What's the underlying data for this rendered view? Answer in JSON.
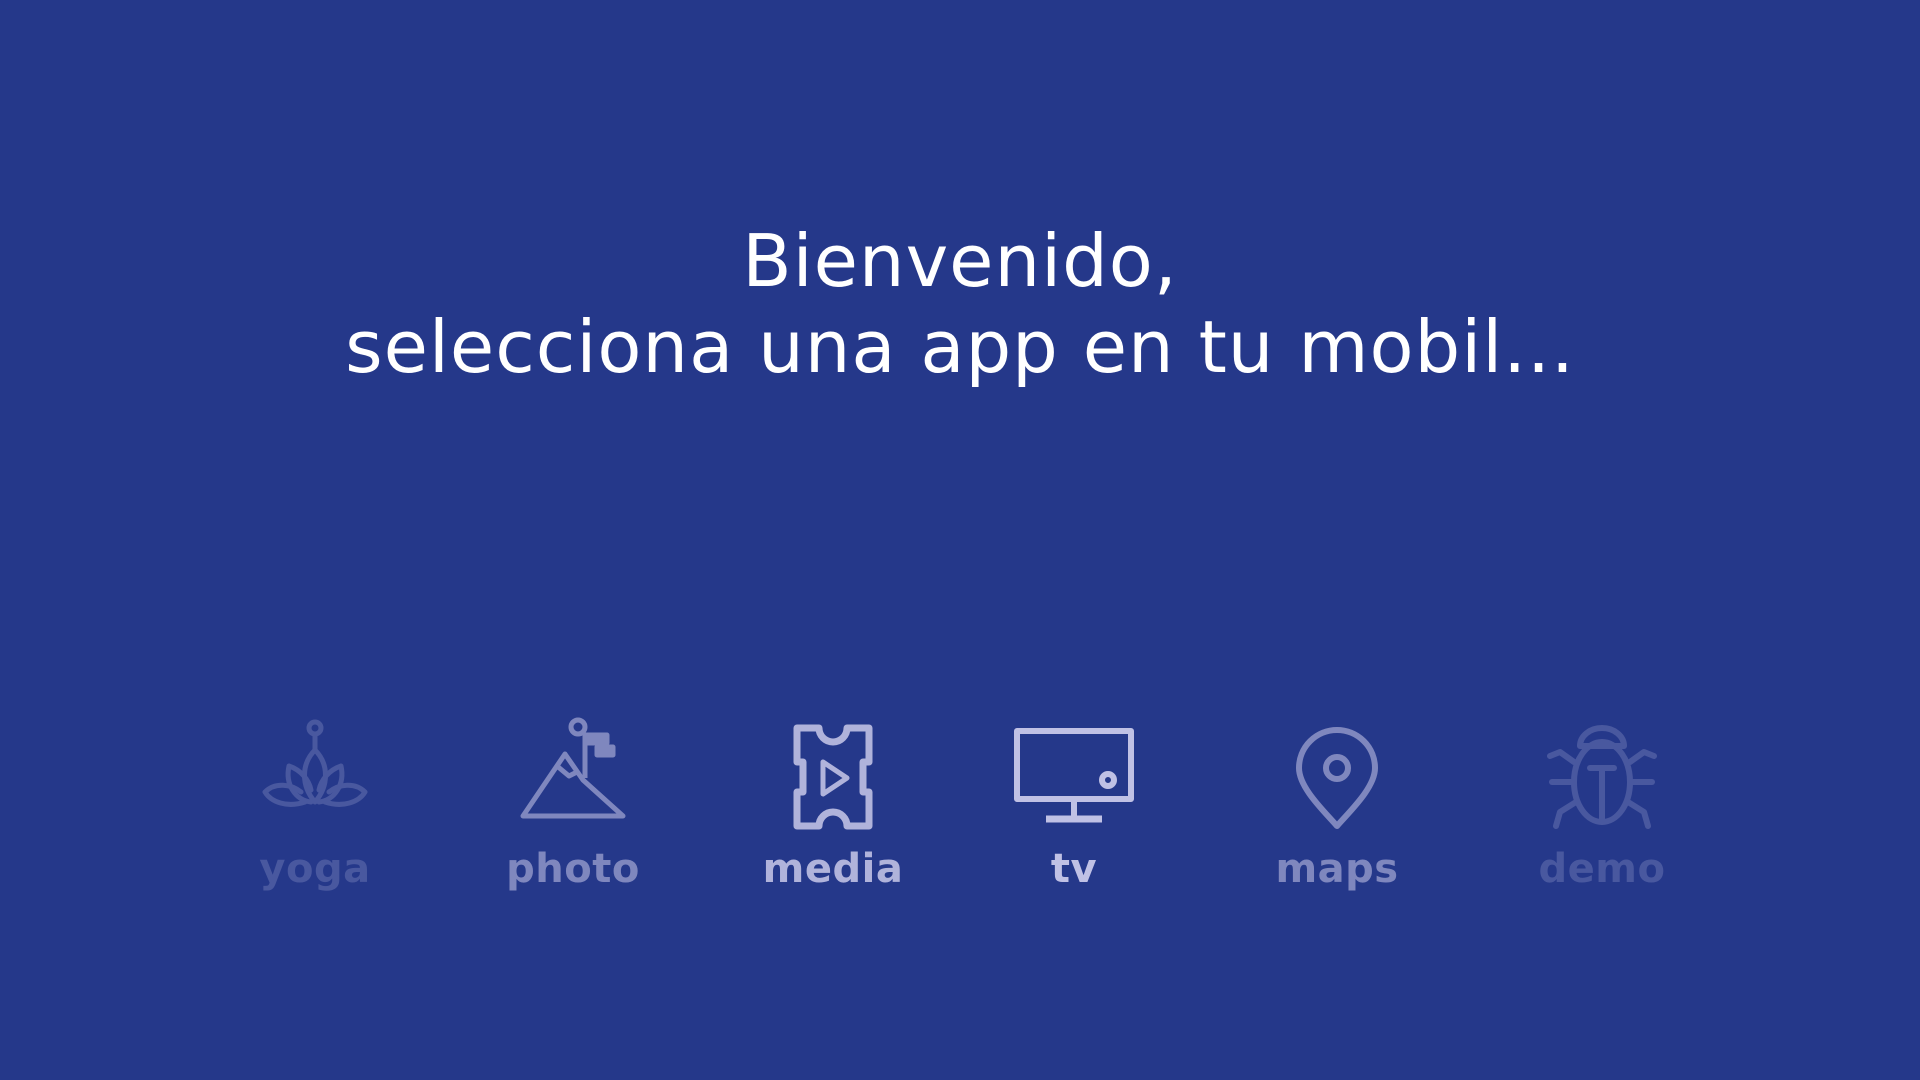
{
  "welcome": {
    "line1": "Bienvenido,",
    "line2": "selecciona una app en tu mobil..."
  },
  "apps": [
    {
      "label": "yoga",
      "icon": "lotus-icon",
      "opacity": 0.22
    },
    {
      "label": "photo",
      "icon": "mountain-photo-icon",
      "opacity": 0.55
    },
    {
      "label": "media",
      "icon": "film-ticket-play-icon",
      "opacity": 0.85
    },
    {
      "label": "tv",
      "icon": "tv-monitor-icon",
      "opacity": 0.95
    },
    {
      "label": "maps",
      "icon": "map-pin-icon",
      "opacity": 0.55
    },
    {
      "label": "demo",
      "icon": "bug-icon",
      "opacity": 0.22
    }
  ],
  "colors": {
    "background": "#25388a",
    "text": "#ffffff",
    "icon": "#c9c9ea"
  }
}
